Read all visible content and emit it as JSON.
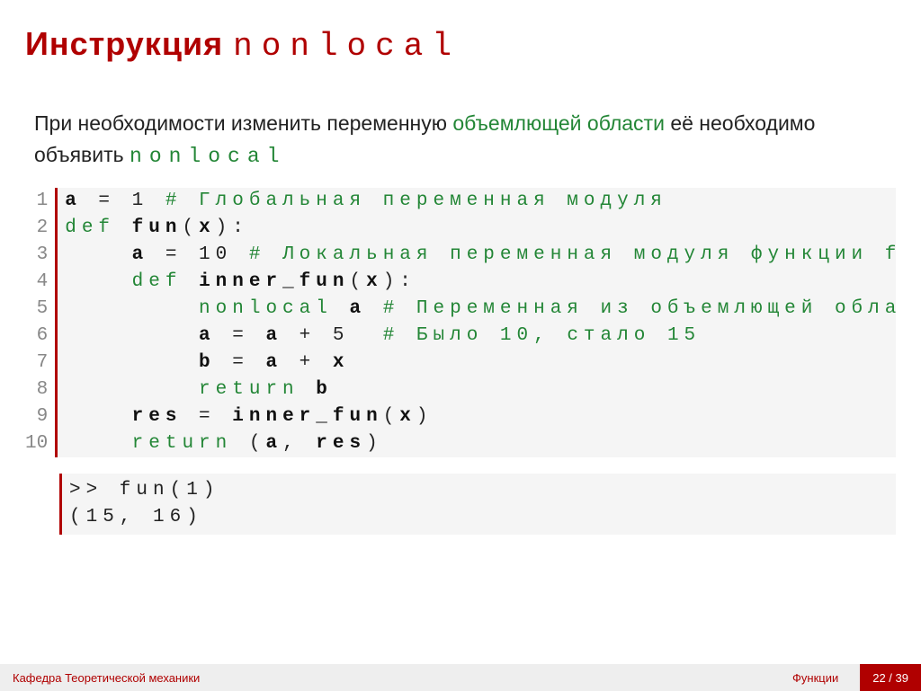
{
  "heading": {
    "prefix": "Инструкция ",
    "keyword": "nonlocal"
  },
  "intro": {
    "part1": "При необходимости изменить переменную ",
    "hi1": "объемлющей области",
    "part2": " её необходимо объявить ",
    "mono": "nonlocal"
  },
  "code": {
    "gutter": "1\n2\n3\n4\n5\n6\n7\n8\n9\n10",
    "l1_a": "a",
    "l1_eq": " = 1 ",
    "l1_c": "# Глобальная переменная модуля",
    "l2_def": "def ",
    "l2_fn": "fun",
    "l2_sig": "(",
    "l2_x": "x",
    "l2_sig2": "):",
    "l3_pad": "    ",
    "l3_a": "a",
    "l3_eq": " = 10 ",
    "l3_c": "# Локальная переменная модуля функции fun",
    "l4_pad": "    ",
    "l4_def": "def ",
    "l4_fn": "inner_fun",
    "l4_sig": "(",
    "l4_x": "x",
    "l4_sig2": "):",
    "l5_pad": "        ",
    "l5_kw": "nonlocal ",
    "l5_a": "a",
    "l5_sp": " ",
    "l5_c": "# Переменная из объемлющей области",
    "l6_pad": "        ",
    "l6_a": "a",
    "l6_eq": " = ",
    "l6_a2": "a",
    "l6_plus": " + 5  ",
    "l6_c": "# Было 10, стало 15",
    "l7_pad": "        ",
    "l7_b": "b",
    "l7_eq": " = ",
    "l7_a": "a",
    "l7_plus": " + ",
    "l7_x": "x",
    "l8_pad": "        ",
    "l8_ret": "return ",
    "l8_b": "b",
    "l9_pad": "    ",
    "l9_res": "res",
    "l9_eq": " = ",
    "l9_fn": "inner_fun",
    "l9_sig": "(",
    "l9_x": "x",
    "l9_sig2": ")",
    "l10_pad": "    ",
    "l10_ret": "return ",
    "l10_p1": "(",
    "l10_a": "a",
    "l10_com": ", ",
    "l10_res": "res",
    "l10_p2": ")"
  },
  "output": ">> fun(1)\n(15, 16)",
  "footer": {
    "dept": "Кафедра Теоретической механики",
    "title": "Функции",
    "page": "22 / 39"
  }
}
